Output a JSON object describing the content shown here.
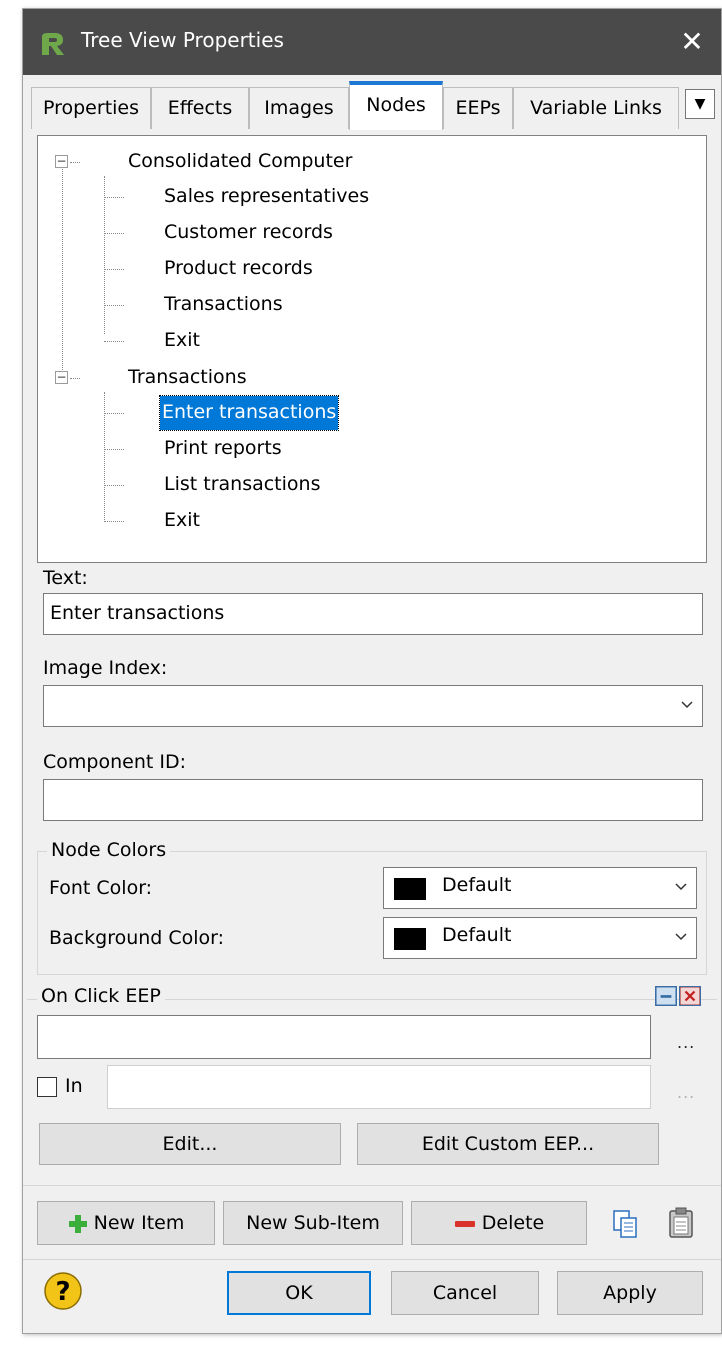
{
  "window": {
    "title": "Tree View Properties",
    "close_glyph": "✕"
  },
  "tabs": [
    {
      "label": "Properties"
    },
    {
      "label": "Effects"
    },
    {
      "label": "Images"
    },
    {
      "label": "Nodes"
    },
    {
      "label": "EEPs"
    },
    {
      "label": "Variable Links"
    }
  ],
  "active_tab": "Nodes",
  "tab_scroll_glyph": "▼",
  "tree": {
    "root1": {
      "label": "Consolidated Computer",
      "expander": "−",
      "children": [
        "Sales representatives",
        "Customer records",
        "Product records",
        "Transactions",
        "Exit"
      ]
    },
    "root2": {
      "label": "Transactions",
      "expander": "−",
      "children": [
        "Enter transactions",
        "Print reports",
        "List transactions",
        "Exit"
      ]
    },
    "selected": "Enter transactions"
  },
  "fields": {
    "text_label": "Text:",
    "text_value": "Enter transactions",
    "image_index_label": "Image Index:",
    "image_index_value": "",
    "component_id_label": "Component ID:",
    "component_id_value": ""
  },
  "node_colors": {
    "group_label": "Node Colors",
    "font_color_label": "Font Color:",
    "font_color_value": "Default",
    "background_color_label": "Background Color:",
    "background_color_value": "Default",
    "swatch_color": "#000000"
  },
  "on_click": {
    "group_label": "On Click EEP",
    "eep_value": "",
    "browse_glyph": "...",
    "in_label": "In",
    "in_checked": false,
    "in_value": "",
    "edit_label": "Edit...",
    "edit_custom_label": "Edit Custom EEP..."
  },
  "item_buttons": {
    "new_item": "New Item",
    "new_sub_item": "New Sub-Item",
    "delete": "Delete"
  },
  "dialog_buttons": {
    "ok": "OK",
    "cancel": "Cancel",
    "apply": "Apply",
    "help_glyph": "?"
  },
  "colors": {
    "titlebar": "#4a4a4a",
    "accent": "#1c78d4",
    "selection": "#0078d7"
  }
}
